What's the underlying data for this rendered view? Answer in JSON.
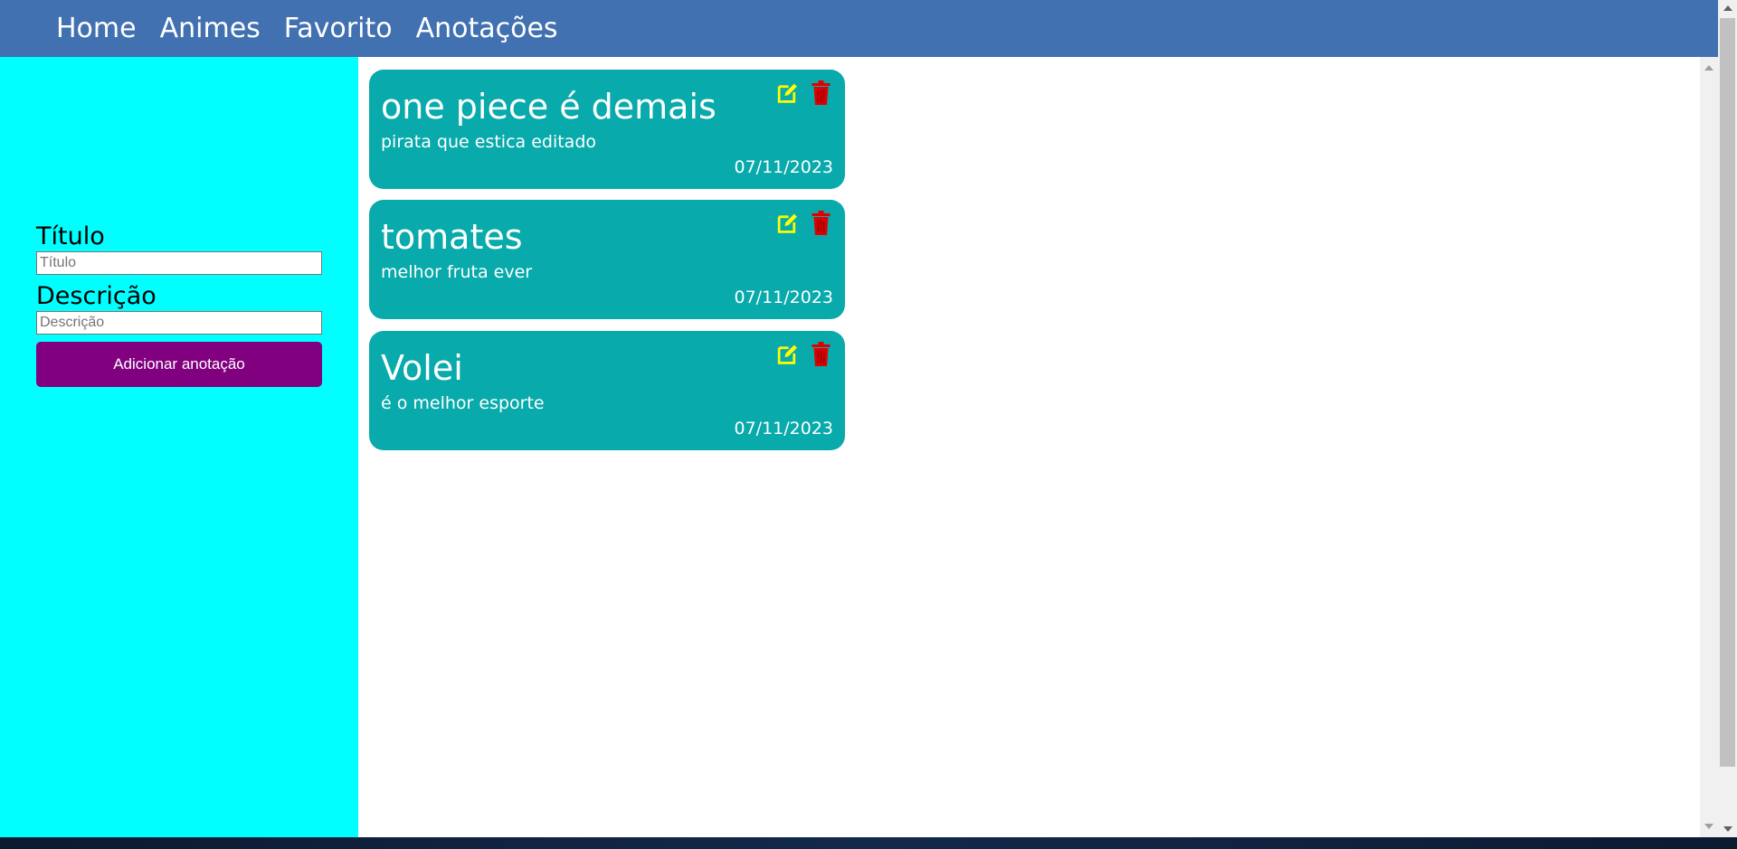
{
  "nav": {
    "links": [
      "Home",
      "Animes",
      "Favorito",
      "Anotações"
    ]
  },
  "form": {
    "title_label": "Título",
    "title_placeholder": "Título",
    "title_value": "",
    "desc_label": "Descrição",
    "desc_placeholder": "Descrição",
    "desc_value": "",
    "submit_label": "Adicionar anotação"
  },
  "notes": [
    {
      "title": "one piece é demais",
      "description": "pirata que estica editado",
      "date": "07/11/2023"
    },
    {
      "title": "tomates",
      "description": "melhor fruta ever",
      "date": "07/11/2023"
    },
    {
      "title": "Volei",
      "description": "é o melhor esporte",
      "date": "07/11/2023"
    }
  ],
  "icons": {
    "edit": "edit-icon",
    "delete": "trash-icon"
  },
  "colors": {
    "navbar": "#4171b0",
    "sidebar": "#00ffff",
    "card": "#08aaab",
    "button": "#800080",
    "edit_icon": "#ffff00",
    "delete_icon": "#e00000"
  }
}
